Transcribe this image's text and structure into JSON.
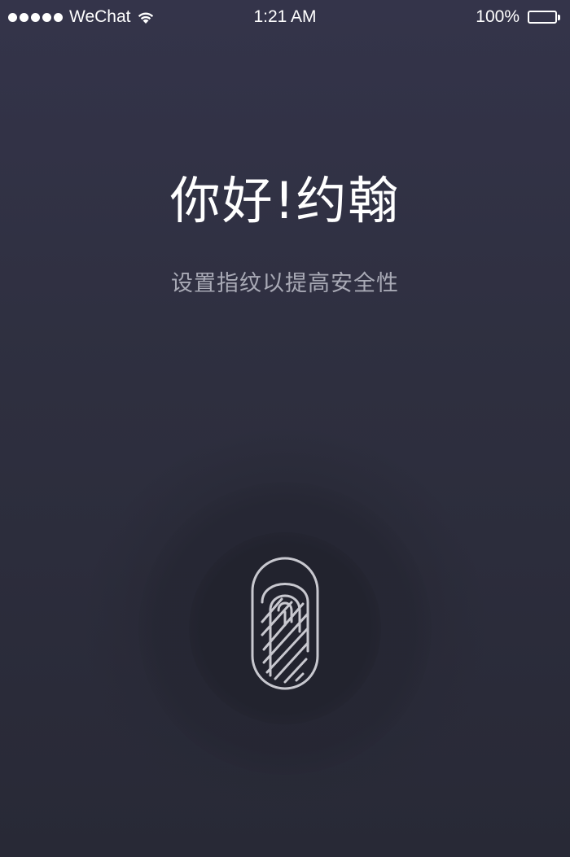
{
  "status_bar": {
    "carrier": "WeChat",
    "time": "1:21 AM",
    "battery": "100%",
    "signal_icon": "signal-dots-icon",
    "wifi_icon": "wifi-icon",
    "battery_icon": "battery-icon"
  },
  "main": {
    "greeting": "你好!约翰",
    "subtitle": "设置指纹以提高安全性",
    "fingerprint_icon": "fingerprint-icon"
  },
  "colors": {
    "background_top": "#34344a",
    "background_bottom": "#282936",
    "text_primary": "#ffffff",
    "text_secondary": "#a9aab6",
    "fingerprint_stroke": "#c8c8cf"
  }
}
